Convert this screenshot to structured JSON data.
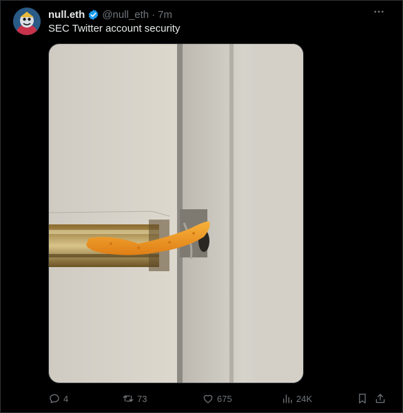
{
  "post": {
    "display_name": "null.eth",
    "handle": "@null_eth",
    "separator": "·",
    "time": "7m",
    "text": "SEC Twitter account security"
  },
  "actions": {
    "replies": "4",
    "reposts": "73",
    "likes": "675",
    "views": "24K"
  },
  "icons": {
    "verified": "verified-badge-icon",
    "more": "more-icon",
    "reply": "reply-icon",
    "repost": "repost-icon",
    "like": "like-icon",
    "views": "views-icon",
    "bookmark": "bookmark-icon",
    "share": "share-icon"
  },
  "colors": {
    "background": "#000000",
    "primary_text": "#e7e9ea",
    "secondary_text": "#71767b",
    "verified": "#1d9bf0",
    "border": "#2f3336"
  }
}
